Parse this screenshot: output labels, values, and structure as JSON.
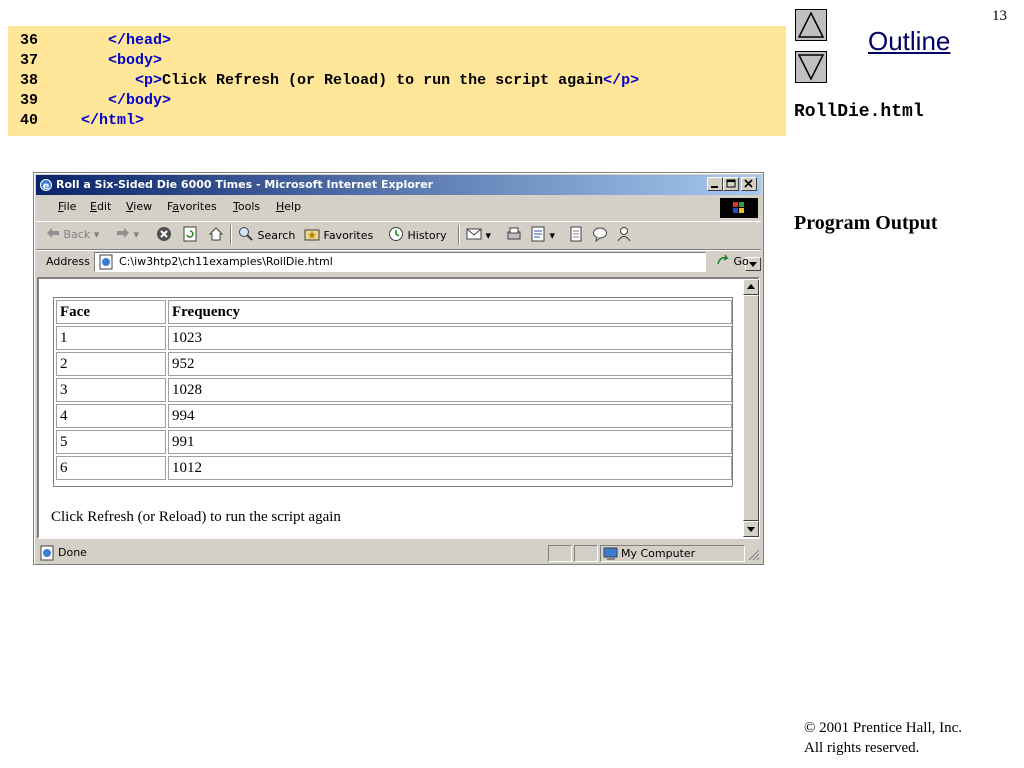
{
  "slide": {
    "page_number": "13",
    "outline_label": "Outline",
    "file_name": "RollDie.html",
    "section_label": "Program Output",
    "copyright_line1": "© 2001 Prentice Hall, Inc.",
    "copyright_line2": "All rights reserved."
  },
  "code": {
    "lines": [
      {
        "num": "36",
        "indent": "    ",
        "tag1": "</head>",
        "text": "",
        "tag2": ""
      },
      {
        "num": "37",
        "indent": "    ",
        "tag1": "<body>",
        "text": "",
        "tag2": ""
      },
      {
        "num": "38",
        "indent": "       ",
        "tag1": "<p>",
        "text": "Click Refresh (or Reload) to run the script again",
        "tag2": "</p>"
      },
      {
        "num": "39",
        "indent": "    ",
        "tag1": "</body>",
        "text": "",
        "tag2": ""
      },
      {
        "num": "40",
        "indent": " ",
        "tag1": "</html>",
        "text": "",
        "tag2": ""
      }
    ]
  },
  "browser": {
    "title": "Roll a Six-Sided Die 6000 Times - Microsoft Internet Explorer",
    "menu": [
      {
        "acc": "F",
        "rest": "ile"
      },
      {
        "acc": "E",
        "rest": "dit"
      },
      {
        "acc": "V",
        "rest": "iew"
      },
      {
        "pre": "F",
        "acc": "a",
        "rest": "vorites"
      },
      {
        "acc": "T",
        "rest": "ools"
      },
      {
        "acc": "H",
        "rest": "elp"
      }
    ],
    "toolbar": {
      "back": "Back",
      "search": "Search",
      "favorites": "Favorites",
      "history": "History"
    },
    "address_label": "Address",
    "address_url": "C:\\iw3htp2\\ch11examples\\RollDie.html",
    "go_label": "Go",
    "status_text": "Done",
    "zone_text": "My Computer",
    "colors": {
      "title_start": "#0a246a",
      "title_end": "#a6caf0",
      "chrome": "#d4d0c8",
      "code_bg": "#ffe699",
      "code_tag": "#0000cc"
    }
  },
  "page": {
    "table_headers": [
      "Face",
      "Frequency"
    ],
    "table_rows": [
      {
        "face": "1",
        "frequency": "1023"
      },
      {
        "face": "2",
        "frequency": "952"
      },
      {
        "face": "3",
        "frequency": "1028"
      },
      {
        "face": "4",
        "frequency": "994"
      },
      {
        "face": "5",
        "frequency": "991"
      },
      {
        "face": "6",
        "frequency": "1012"
      }
    ],
    "paragraph": "Click Refresh (or Reload) to run the script again"
  }
}
